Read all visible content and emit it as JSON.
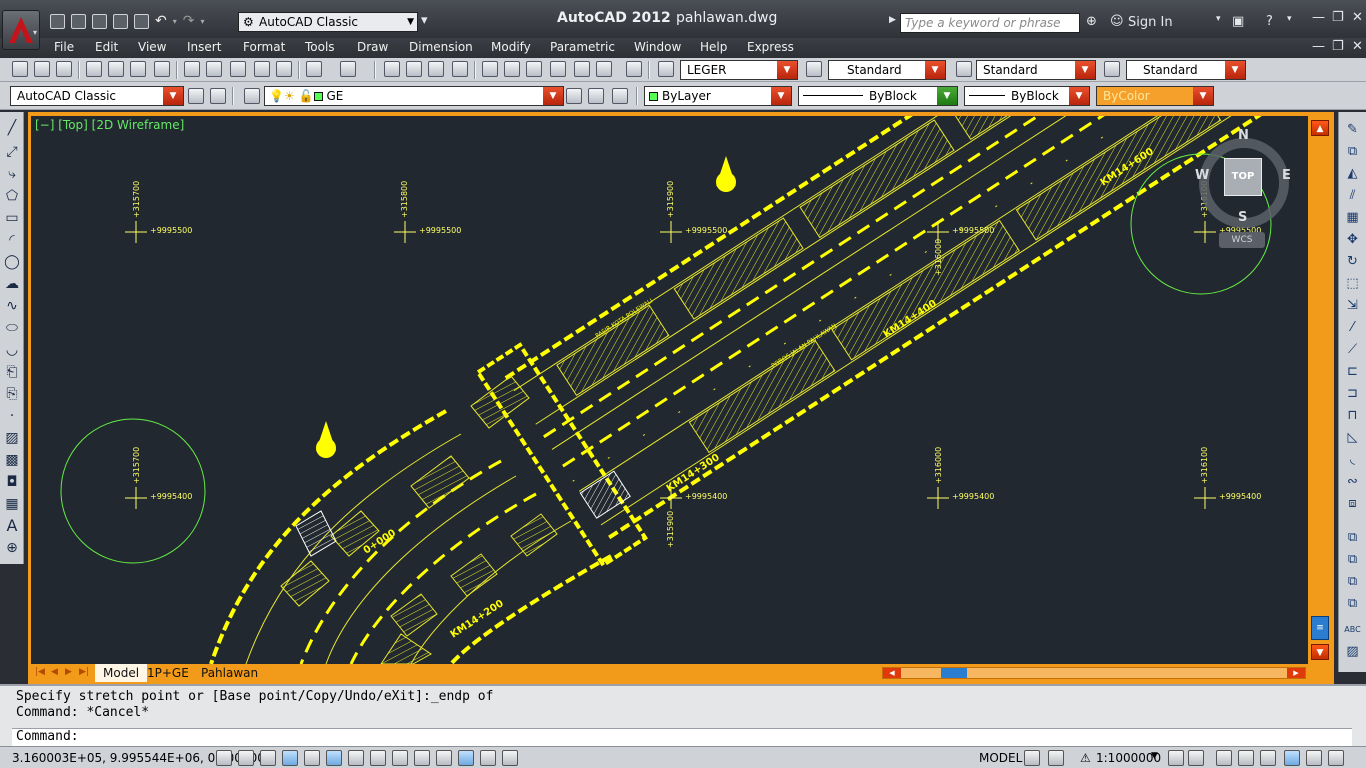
{
  "titlebar": {
    "app": "AutoCAD 2012",
    "file": "pahlawan.dwg",
    "workspace": "AutoCAD Classic",
    "search_placeholder": "Type a keyword or phrase",
    "signin": "Sign In"
  },
  "menu": [
    "File",
    "Edit",
    "View",
    "Insert",
    "Format",
    "Tools",
    "Draw",
    "Dimension",
    "Modify",
    "Parametric",
    "Window",
    "Help",
    "Express"
  ],
  "toolbar": {
    "textstyle": "LEGER",
    "dimstyle": "Standard",
    "tablestyle": "Standard",
    "mleaderstyle": "Standard",
    "workspace": "AutoCAD Classic",
    "layer": "GE",
    "color": "ByLayer",
    "linetype": "ByBlock",
    "lineweight": "ByBlock",
    "plotstyle": "ByColor"
  },
  "viewport": {
    "label": "[−] [Top] [2D Wireframe]",
    "viewcube": {
      "top": "TOP",
      "n": "N",
      "s": "S",
      "e": "E",
      "w": "W",
      "ucs": "WCS"
    }
  },
  "grid_labels": {
    "e_top": [
      "+315700",
      "+315800",
      "+315900",
      "+316100"
    ],
    "n_top": [
      "+9995500",
      "+9995500",
      "+9995500",
      "+9995500",
      "+9995500"
    ],
    "e_bot": [
      "+315700",
      "+316000",
      "+316100",
      "+315900"
    ],
    "n_bot": [
      "+9995400",
      "+9995400",
      "+9995400",
      "+9995400"
    ],
    "e_mid": "+316000"
  },
  "road_labels": {
    "km_600": "KM14+600",
    "km_400": "KM14+400",
    "km_300": "KM14+300",
    "km_200": "KM14+200",
    "km_000": "0+000",
    "pasir_kota": "PASIR KOTA POLEWALI",
    "poros_jalan": "POROS JALAN PAHLAWAN"
  },
  "tabs": [
    "Model",
    "1P+GE",
    "Pahlawan"
  ],
  "command": {
    "line1": "Specify stretch point or [Base point/Copy/Undo/eXit]:_endp of",
    "line2": "Command: *Cancel*",
    "prompt": "Command:"
  },
  "status": {
    "coords": "3.160003E+05, 9.995544E+06, 0.000000",
    "model": "MODEL",
    "scale": "1:1000000"
  }
}
